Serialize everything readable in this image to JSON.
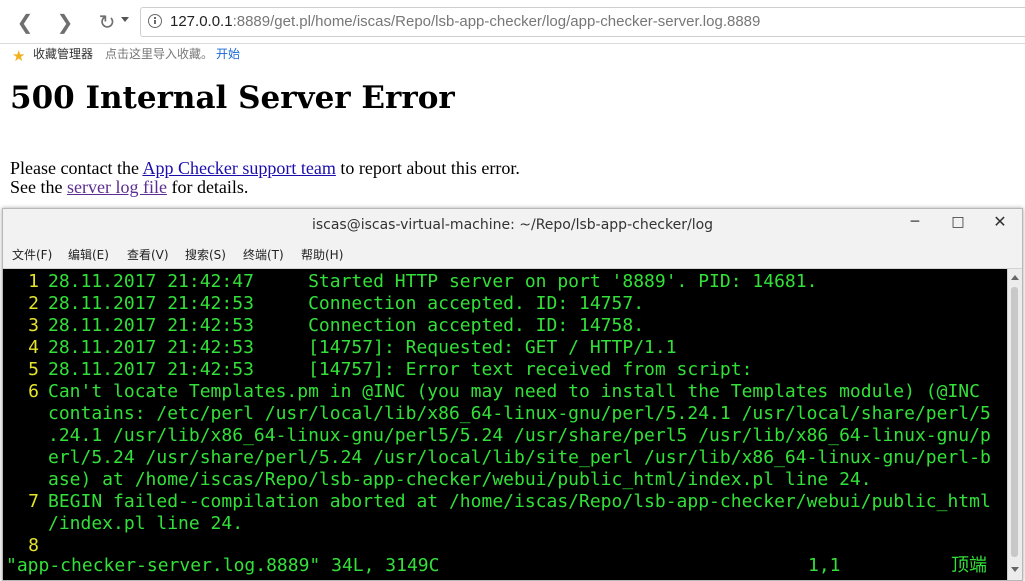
{
  "browser": {
    "url_host": "127.0.0.1",
    "url_rest": ":8889/get.pl/home/iscas/Repo/lsb-app-checker/log/app-checker-server.log.8889",
    "bookmarks": {
      "manager": "收藏管理器",
      "hint": "点击这里导入收藏。",
      "start": "开始"
    }
  },
  "page": {
    "title": "500 Internal Server Error",
    "line1_prefix": "Please contact the ",
    "line1_link": "App Checker support team",
    "line1_suffix": " to report about this error.",
    "line2_prefix": "See the ",
    "line2_link": "server log file",
    "line2_suffix": " for details."
  },
  "terminal": {
    "title": "iscas@iscas-virtual-machine: ~/Repo/lsb-app-checker/log",
    "menu": [
      "文件(F)",
      "编辑(E)",
      "查看(V)",
      "搜索(S)",
      "终端(T)",
      "帮助(H)"
    ],
    "lines": [
      {
        "num": "1",
        "text": "28.11.2017 21:42:47     Started HTTP server on port '8889'. PID: 14681."
      },
      {
        "num": "2",
        "text": "28.11.2017 21:42:53     Connection accepted. ID: 14757."
      },
      {
        "num": "3",
        "text": "28.11.2017 21:42:53     Connection accepted. ID: 14758."
      },
      {
        "num": "4",
        "text": "28.11.2017 21:42:53     [14757]: Requested: GET / HTTP/1.1"
      },
      {
        "num": "5",
        "text": "28.11.2017 21:42:53     [14757]: Error text received from script:"
      },
      {
        "num": "6",
        "text": "Can't locate Templates.pm in @INC (you may need to install the Templates module) (@INC"
      },
      {
        "num": "",
        "text": "contains: /etc/perl /usr/local/lib/x86_64-linux-gnu/perl/5.24.1 /usr/local/share/perl/5"
      },
      {
        "num": "",
        "text": ".24.1 /usr/lib/x86_64-linux-gnu/perl5/5.24 /usr/share/perl5 /usr/lib/x86_64-linux-gnu/p"
      },
      {
        "num": "",
        "text": "erl/5.24 /usr/share/perl/5.24 /usr/local/lib/site_perl /usr/lib/x86_64-linux-gnu/perl-b"
      },
      {
        "num": "",
        "text": "ase) at /home/iscas/Repo/lsb-app-checker/webui/public_html/index.pl line 24."
      },
      {
        "num": "7",
        "text": "BEGIN failed--compilation aborted at /home/iscas/Repo/lsb-app-checker/webui/public_html"
      },
      {
        "num": "",
        "text": "/index.pl line 24."
      },
      {
        "num": "8",
        "text": ""
      }
    ],
    "status_file": "\"app-checker-server.log.8889\" 34L, 3149C",
    "status_pos": "1,1",
    "status_top": "顶端"
  },
  "colors": {
    "terminal_bg": "#000000",
    "terminal_text": "#33e03a",
    "line_number": "#e4e42a",
    "link": "#1a0dab",
    "visited_link": "#5a2d91"
  }
}
